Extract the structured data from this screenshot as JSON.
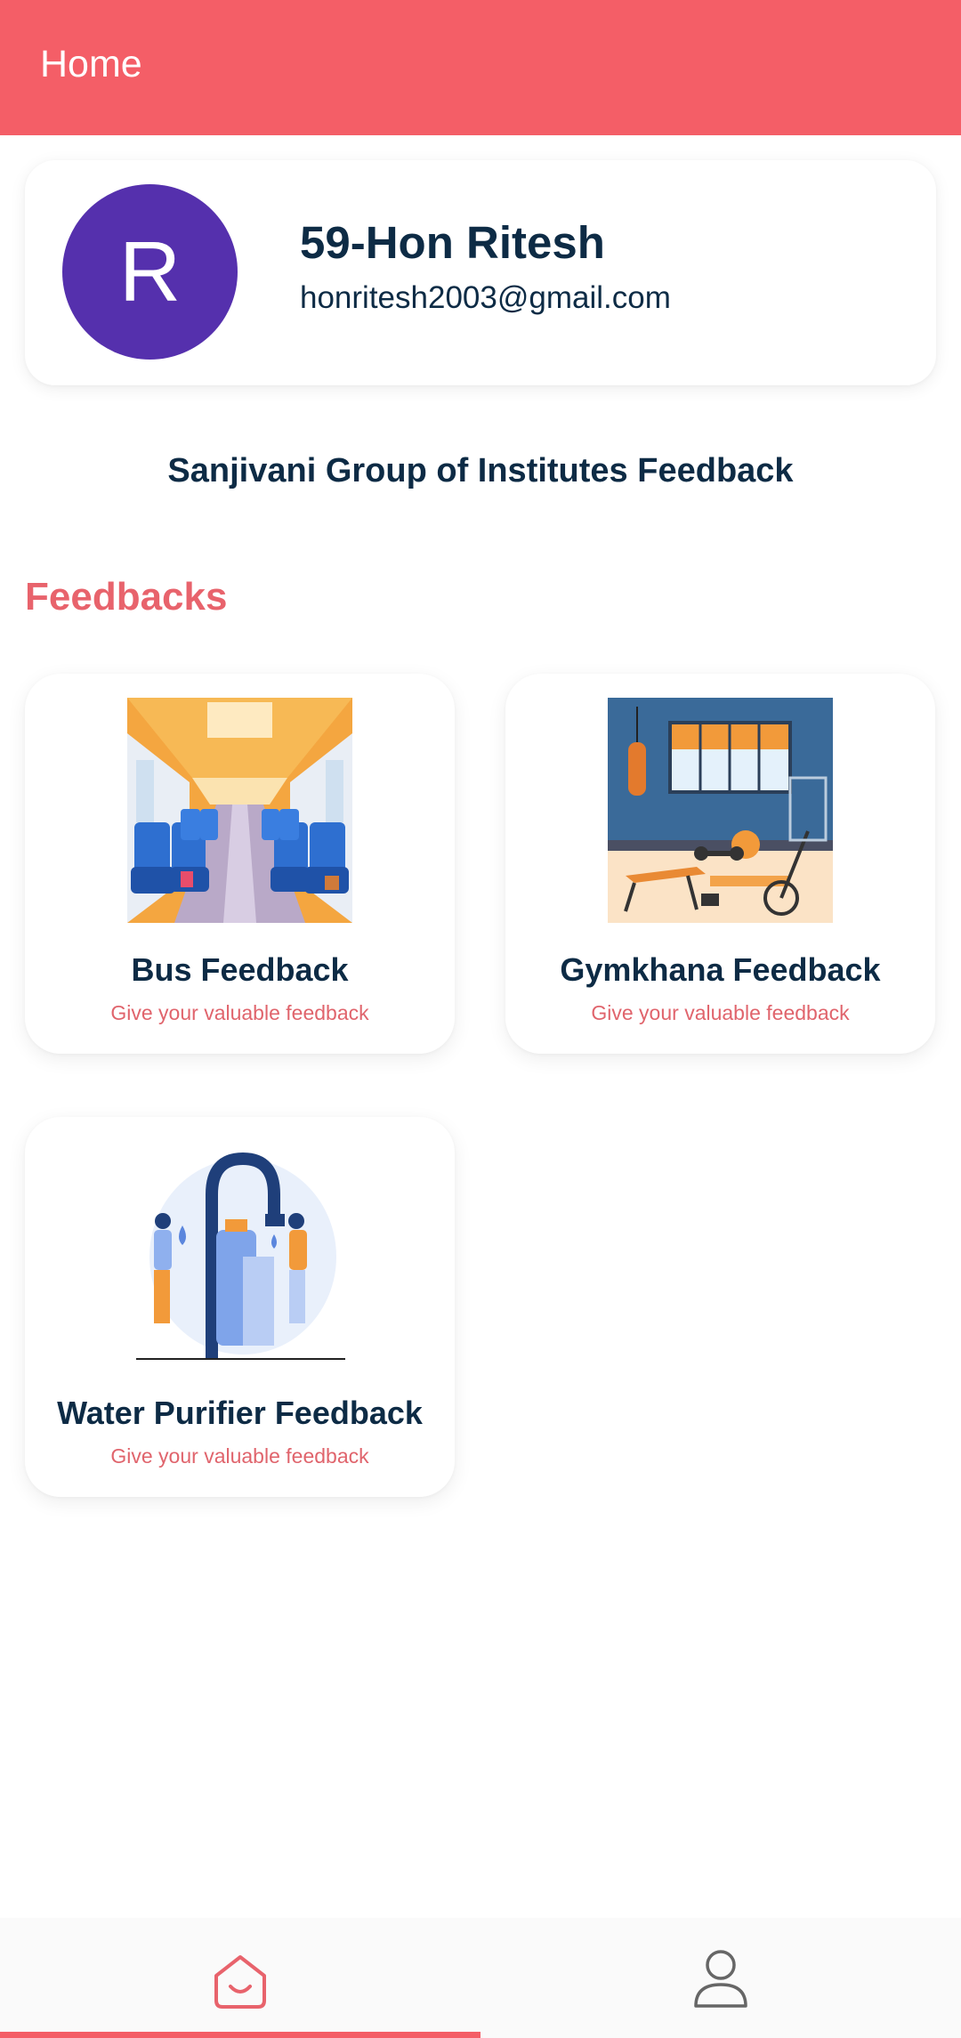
{
  "appbar": {
    "title": "Home"
  },
  "profile": {
    "initial": "R",
    "name": "59-Hon Ritesh",
    "email": "honritesh2003@gmail.com",
    "avatar_color": "#5530ad"
  },
  "org_title": "Sanjivani Group of Institutes Feedback",
  "section_title": "Feedbacks",
  "feedbacks": [
    {
      "title": "Bus Feedback",
      "subtitle": "Give your valuable feedback",
      "icon": "bus-interior-illustration"
    },
    {
      "title": "Gymkhana Feedback",
      "subtitle": "Give your valuable feedback",
      "icon": "gym-illustration"
    },
    {
      "title": "Water Purifier Feedback",
      "subtitle": "Give your valuable feedback",
      "icon": "water-purifier-illustration"
    }
  ],
  "bottom_nav": {
    "items": [
      {
        "icon": "home-smile-icon",
        "selected": true
      },
      {
        "icon": "profile-icon",
        "selected": false
      }
    ]
  },
  "colors": {
    "primary": "#f45e67",
    "text_dark": "#0d2b45",
    "accent_text": "#e8636c"
  }
}
